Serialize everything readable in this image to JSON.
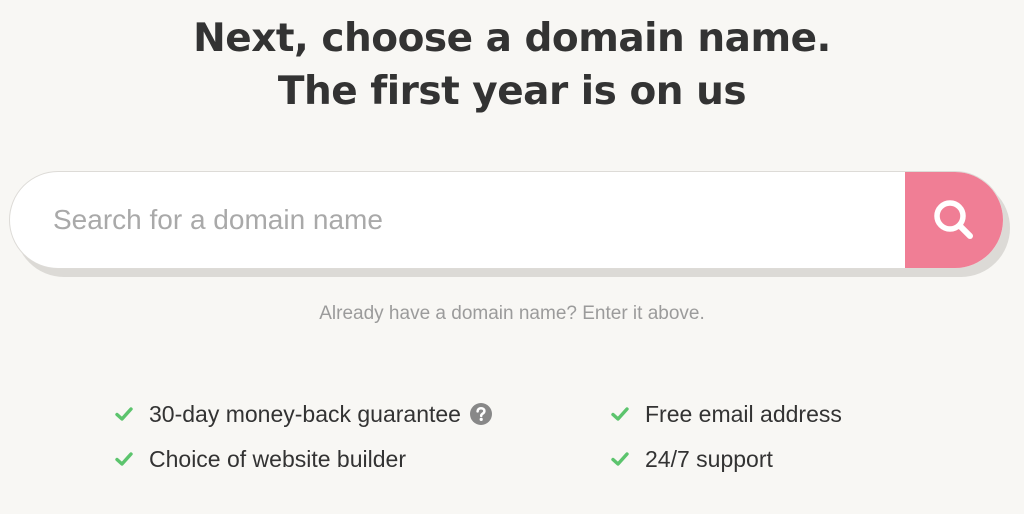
{
  "heading": {
    "line1": "Next, choose a domain name.",
    "line2": "The first year is on us"
  },
  "search": {
    "placeholder": "Search for a domain name",
    "value": "",
    "button_icon": "search-icon",
    "button_color": "#f07e95"
  },
  "hint": "Already have a domain name? Enter it above.",
  "features": {
    "check_color": "#5cc46d",
    "items": [
      {
        "label": "30-day money-back guarantee",
        "help_icon": "question-circle-icon"
      },
      {
        "label": "Free email address"
      },
      {
        "label": "Choice of website builder"
      },
      {
        "label": "24/7 support"
      }
    ]
  }
}
